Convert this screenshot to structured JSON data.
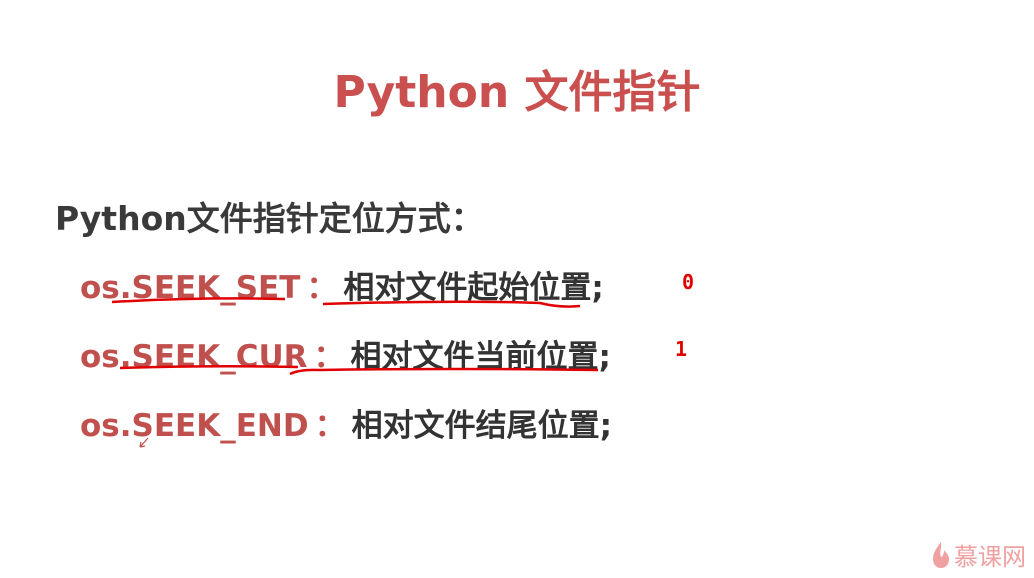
{
  "slide": {
    "title": "Python 文件指针",
    "heading": "Python文件指针定位方式：",
    "rows": [
      {
        "prefix": "os.",
        "key": "SEEK_SET",
        "sep": "：",
        "desc": "相对文件起始位置;",
        "note": "0"
      },
      {
        "prefix": "os.",
        "key": "SEEK_CUR",
        "sep": "：",
        "desc": "相对文件当前位置;",
        "note": "1"
      },
      {
        "prefix": "os.",
        "key": "SEEK_END",
        "sep": "：",
        "desc": "相对文件结尾位置;"
      }
    ]
  },
  "watermark": {
    "text": "慕课网"
  },
  "colors": {
    "accent": "#c0504d",
    "annotation": "#e00000",
    "text": "#333333"
  }
}
